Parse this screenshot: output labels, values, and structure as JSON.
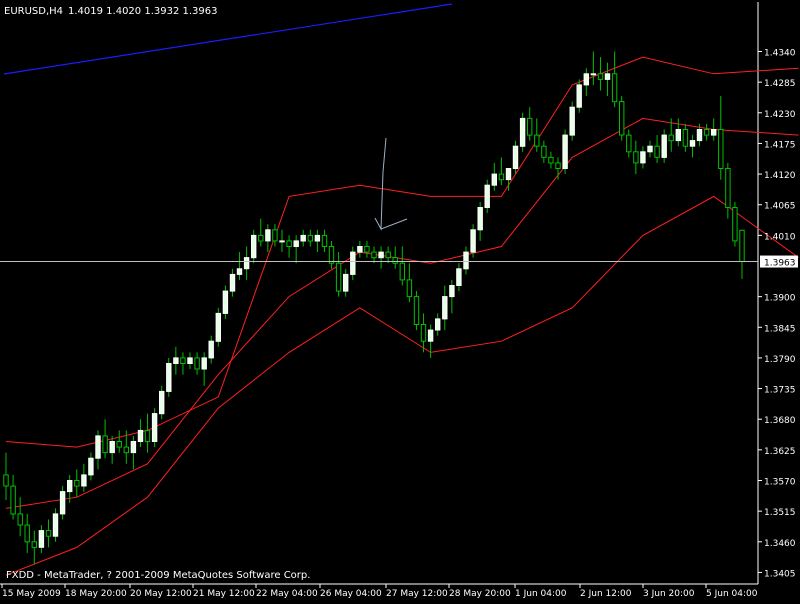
{
  "header": {
    "symbol": "EURUSD,H4",
    "ohlc": "1.4019 1.4020 1.3932 1.3963"
  },
  "footer": {
    "copyright": "FXDD - MetaTrader, ? 2001-2009 MetaQuotes Software Corp."
  },
  "colors": {
    "background": "#000000",
    "axis": "#ffffff",
    "bull_body": "#ffffff",
    "bull_fill": "#e8ffe8",
    "bear_body": "#000000",
    "wick": "#00c000",
    "bands": "#ff2020",
    "trendline": "#1c1cff",
    "arrow": "#a0b0c8",
    "price_line": "#c0c0c0"
  },
  "chart_data": {
    "type": "candlestick",
    "indicator": "Bollinger Bands",
    "ylim": [
      1.3395,
      1.4375
    ],
    "y_ticks": [
      "1.4340",
      "1.4285",
      "1.4230",
      "1.4175",
      "1.4120",
      "1.4065",
      "1.4010",
      "1.3963",
      "1.3900",
      "1.3845",
      "1.3790",
      "1.3735",
      "1.3680",
      "1.3625",
      "1.3570",
      "1.3515",
      "1.3460",
      "1.3405"
    ],
    "current_price": "1.3963",
    "x_labels": [
      "15 May 2009",
      "18 May 20:00",
      "20 May 12:00",
      "21 May 12:00",
      "22 May 04:00",
      "26 May 04:00",
      "27 May 12:00",
      "28 May 20:00",
      "1 Jun 04:00",
      "2 Jun 12:00",
      "3 Jun 20:00",
      "5 Jun 04:00"
    ],
    "candles": [
      [
        1.358,
        1.362,
        1.3535,
        1.356
      ],
      [
        1.356,
        1.358,
        1.35,
        1.351
      ],
      [
        1.351,
        1.354,
        1.347,
        1.349
      ],
      [
        1.349,
        1.351,
        1.344,
        1.346
      ],
      [
        1.346,
        1.348,
        1.342,
        1.345
      ],
      [
        1.345,
        1.349,
        1.344,
        1.348
      ],
      [
        1.348,
        1.35,
        1.345,
        1.347
      ],
      [
        1.347,
        1.352,
        1.346,
        1.351
      ],
      [
        1.351,
        1.356,
        1.35,
        1.355
      ],
      [
        1.355,
        1.358,
        1.353,
        1.357
      ],
      [
        1.357,
        1.359,
        1.354,
        1.356
      ],
      [
        1.356,
        1.36,
        1.355,
        1.358
      ],
      [
        1.358,
        1.362,
        1.357,
        1.361
      ],
      [
        1.361,
        1.366,
        1.359,
        1.365
      ],
      [
        1.365,
        1.368,
        1.361,
        1.362
      ],
      [
        1.362,
        1.365,
        1.36,
        1.364
      ],
      [
        1.364,
        1.366,
        1.362,
        1.363
      ],
      [
        1.363,
        1.366,
        1.36,
        1.362
      ],
      [
        1.362,
        1.365,
        1.359,
        1.364
      ],
      [
        1.364,
        1.368,
        1.363,
        1.366
      ],
      [
        1.366,
        1.369,
        1.362,
        1.364
      ],
      [
        1.364,
        1.37,
        1.363,
        1.369
      ],
      [
        1.369,
        1.374,
        1.368,
        1.373
      ],
      [
        1.373,
        1.379,
        1.372,
        1.378
      ],
      [
        1.378,
        1.381,
        1.376,
        1.379
      ],
      [
        1.379,
        1.38,
        1.376,
        1.378
      ],
      [
        1.378,
        1.38,
        1.377,
        1.379
      ],
      [
        1.379,
        1.38,
        1.376,
        1.377
      ],
      [
        1.377,
        1.38,
        1.374,
        1.379
      ],
      [
        1.379,
        1.383,
        1.378,
        1.382
      ],
      [
        1.382,
        1.388,
        1.381,
        1.387
      ],
      [
        1.387,
        1.392,
        1.386,
        1.391
      ],
      [
        1.391,
        1.395,
        1.39,
        1.394
      ],
      [
        1.394,
        1.398,
        1.393,
        1.395
      ],
      [
        1.395,
        1.399,
        1.393,
        1.397
      ],
      [
        1.397,
        1.402,
        1.396,
        1.401
      ],
      [
        1.401,
        1.404,
        1.399,
        1.4
      ],
      [
        1.4,
        1.403,
        1.398,
        1.402
      ],
      [
        1.402,
        1.403,
        1.399,
        1.4
      ],
      [
        1.4,
        1.402,
        1.398,
        1.4
      ],
      [
        1.4,
        1.401,
        1.397,
        1.399
      ],
      [
        1.399,
        1.401,
        1.396,
        1.4
      ],
      [
        1.4,
        1.402,
        1.399,
        1.401
      ],
      [
        1.401,
        1.402,
        1.399,
        1.4
      ],
      [
        1.4,
        1.402,
        1.398,
        1.401
      ],
      [
        1.401,
        1.402,
        1.398,
        1.399
      ],
      [
        1.399,
        1.4,
        1.395,
        1.396
      ],
      [
        1.396,
        1.398,
        1.39,
        1.391
      ],
      [
        1.391,
        1.395,
        1.39,
        1.394
      ],
      [
        1.394,
        1.399,
        1.393,
        1.398
      ],
      [
        1.398,
        1.4,
        1.397,
        1.399
      ],
      [
        1.399,
        1.4,
        1.397,
        1.398
      ],
      [
        1.398,
        1.399,
        1.396,
        1.397
      ],
      [
        1.397,
        1.399,
        1.395,
        1.398
      ],
      [
        1.398,
        1.399,
        1.396,
        1.397
      ],
      [
        1.397,
        1.399,
        1.395,
        1.396
      ],
      [
        1.396,
        1.399,
        1.392,
        1.393
      ],
      [
        1.393,
        1.396,
        1.389,
        1.39
      ],
      [
        1.39,
        1.391,
        1.384,
        1.385
      ],
      [
        1.385,
        1.387,
        1.38,
        1.382
      ],
      [
        1.382,
        1.385,
        1.379,
        1.384
      ],
      [
        1.384,
        1.387,
        1.383,
        1.386
      ],
      [
        1.386,
        1.392,
        1.384,
        1.39
      ],
      [
        1.39,
        1.393,
        1.387,
        1.392
      ],
      [
        1.392,
        1.396,
        1.391,
        1.395
      ],
      [
        1.395,
        1.399,
        1.394,
        1.398
      ],
      [
        1.398,
        1.403,
        1.397,
        1.402
      ],
      [
        1.402,
        1.407,
        1.4,
        1.406
      ],
      [
        1.406,
        1.411,
        1.405,
        1.41
      ],
      [
        1.41,
        1.414,
        1.409,
        1.412
      ],
      [
        1.412,
        1.415,
        1.41,
        1.411
      ],
      [
        1.411,
        1.413,
        1.409,
        1.413
      ],
      [
        1.413,
        1.418,
        1.412,
        1.417
      ],
      [
        1.417,
        1.423,
        1.416,
        1.422
      ],
      [
        1.422,
        1.424,
        1.418,
        1.419
      ],
      [
        1.419,
        1.422,
        1.416,
        1.417
      ],
      [
        1.417,
        1.418,
        1.414,
        1.415
      ],
      [
        1.415,
        1.416,
        1.413,
        1.414
      ],
      [
        1.414,
        1.415,
        1.411,
        1.413
      ],
      [
        1.413,
        1.42,
        1.412,
        1.419
      ],
      [
        1.419,
        1.425,
        1.418,
        1.424
      ],
      [
        1.424,
        1.429,
        1.423,
        1.428
      ],
      [
        1.428,
        1.431,
        1.426,
        1.43
      ],
      [
        1.43,
        1.434,
        1.428,
        1.43
      ],
      [
        1.43,
        1.433,
        1.427,
        1.429
      ],
      [
        1.429,
        1.432,
        1.426,
        1.43
      ],
      [
        1.43,
        1.434,
        1.424,
        1.425
      ],
      [
        1.425,
        1.426,
        1.418,
        1.419
      ],
      [
        1.419,
        1.42,
        1.415,
        1.416
      ],
      [
        1.416,
        1.418,
        1.412,
        1.414
      ],
      [
        1.414,
        1.417,
        1.413,
        1.416
      ],
      [
        1.416,
        1.418,
        1.415,
        1.417
      ],
      [
        1.417,
        1.419,
        1.414,
        1.415
      ],
      [
        1.415,
        1.42,
        1.414,
        1.419
      ],
      [
        1.419,
        1.422,
        1.416,
        1.418
      ],
      [
        1.418,
        1.422,
        1.417,
        1.42
      ],
      [
        1.42,
        1.421,
        1.416,
        1.417
      ],
      [
        1.417,
        1.419,
        1.415,
        1.418
      ],
      [
        1.418,
        1.421,
        1.417,
        1.42
      ],
      [
        1.42,
        1.421,
        1.418,
        1.419
      ],
      [
        1.419,
        1.422,
        1.418,
        1.42
      ],
      [
        1.42,
        1.426,
        1.411,
        1.413
      ],
      [
        1.413,
        1.414,
        1.404,
        1.406
      ],
      [
        1.406,
        1.407,
        1.399,
        1.4
      ],
      [
        1.4019,
        1.402,
        1.3932,
        1.3963
      ]
    ],
    "bollinger": {
      "upper": [
        [
          0,
          1.364
        ],
        [
          10,
          1.363
        ],
        [
          20,
          1.366
        ],
        [
          30,
          1.372
        ],
        [
          40,
          1.408
        ],
        [
          50,
          1.41
        ],
        [
          60,
          1.408
        ],
        [
          70,
          1.408
        ],
        [
          80,
          1.428
        ],
        [
          90,
          1.433
        ],
        [
          100,
          1.43
        ],
        [
          112,
          1.431
        ]
      ],
      "middle": [
        [
          0,
          1.352
        ],
        [
          10,
          1.354
        ],
        [
          20,
          1.36
        ],
        [
          30,
          1.376
        ],
        [
          40,
          1.39
        ],
        [
          50,
          1.398
        ],
        [
          60,
          1.396
        ],
        [
          70,
          1.399
        ],
        [
          80,
          1.415
        ],
        [
          90,
          1.422
        ],
        [
          100,
          1.42
        ],
        [
          112,
          1.419
        ]
      ],
      "lower": [
        [
          0,
          1.34
        ],
        [
          10,
          1.345
        ],
        [
          20,
          1.354
        ],
        [
          30,
          1.37
        ],
        [
          40,
          1.38
        ],
        [
          50,
          1.388
        ],
        [
          60,
          1.38
        ],
        [
          70,
          1.382
        ],
        [
          80,
          1.388
        ],
        [
          90,
          1.401
        ],
        [
          100,
          1.408
        ],
        [
          112,
          1.397
        ]
      ]
    }
  }
}
